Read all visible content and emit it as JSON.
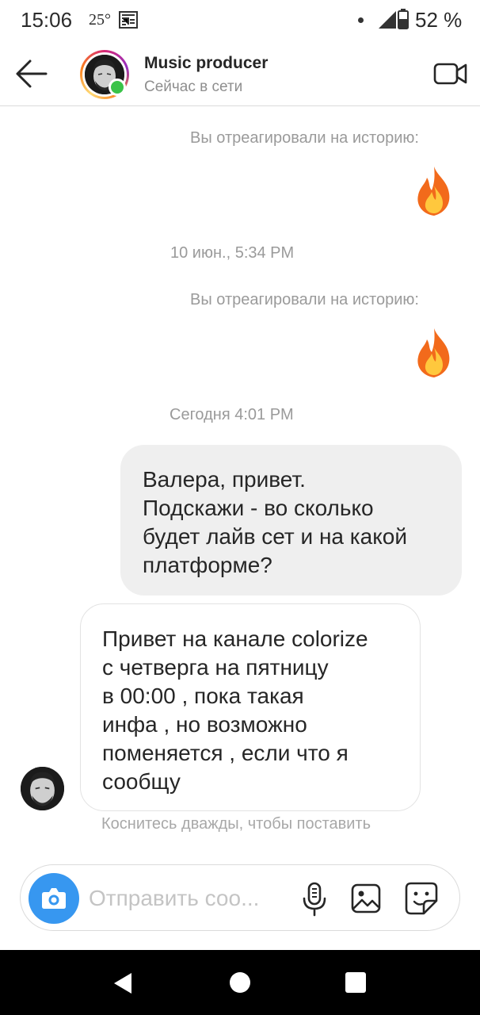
{
  "status_bar": {
    "time": "15:06",
    "temperature": "25°",
    "weather_icon": "weather-icon",
    "battery_percent": "52 %"
  },
  "header": {
    "contact_name": "Music producer",
    "contact_status": "Сейчас в сети",
    "online_color": "#3ac348"
  },
  "chat": {
    "reaction_note_1": "Вы отреагировали на историю:",
    "reaction_emoji_1": "fire-icon",
    "timestamp_1": "10 июн., 5:34 PM",
    "reaction_note_2": "Вы отреагировали на историю:",
    "reaction_emoji_2": "fire-icon",
    "timestamp_2": "Сегодня 4:01 PM",
    "outgoing_message": "Валера, привет.\nПодскажи - во сколько\nбудет лайв сет и на какой\nплатформе?",
    "incoming_message": "Привет на канале colorize\nс четверга на пятницу\nв 00:00 , пока такая\nинфа , но возможно\nпоменяется , если что я\nсообщу",
    "double_tap_hint": "Коснитесь дважды, чтобы поставить"
  },
  "composer": {
    "placeholder": "Отправить соо...",
    "accent_color": "#3797f0"
  }
}
